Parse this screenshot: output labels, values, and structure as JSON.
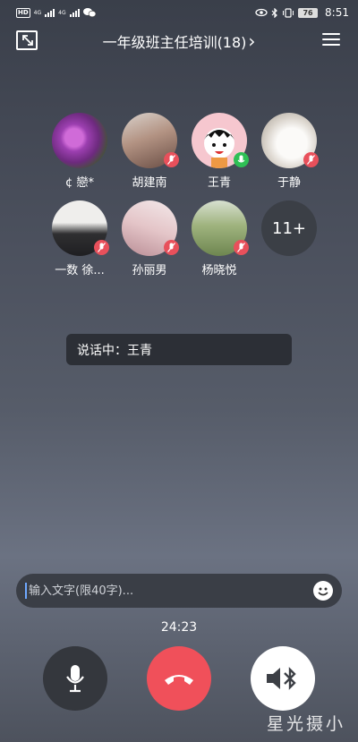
{
  "status_bar": {
    "hd_badge": "HD",
    "network_1": "4G",
    "network_2": "4G",
    "battery": "76",
    "time": "8:51"
  },
  "header": {
    "title": "一年级班主任培训(18)",
    "chevron": "›"
  },
  "participants": [
    {
      "name": "¢ 戀*",
      "mic": "none",
      "avatar_color": "#8a3fa6"
    },
    {
      "name": "胡建南",
      "mic": "muted",
      "avatar_color": "#b9a89a"
    },
    {
      "name": "王青",
      "mic": "active",
      "avatar_color": "#f2b8c1"
    },
    {
      "name": "于静",
      "mic": "muted",
      "avatar_color": "#d8d4cf"
    },
    {
      "name": "一数  徐...",
      "mic": "muted",
      "avatar_color": "#e6e4e1"
    },
    {
      "name": "孙丽男",
      "mic": "muted",
      "avatar_color": "#e0c0c2"
    },
    {
      "name": "杨晓悦",
      "mic": "muted",
      "avatar_color": "#8fa36c"
    }
  ],
  "more_count": "11+",
  "speaking_label": "说话中：王青",
  "message_input": {
    "placeholder": "输入文字(限40字)...",
    "value": ""
  },
  "call_timer": "24:23",
  "controls": {
    "mic": "microphone-icon",
    "hangup": "hangup-icon",
    "speaker": "bluetooth-speaker-icon"
  },
  "watermark": "星光摄小",
  "colors": {
    "muted_badge": "#e8505b",
    "active_badge": "#2fbf55",
    "hangup": "#f0505a"
  }
}
